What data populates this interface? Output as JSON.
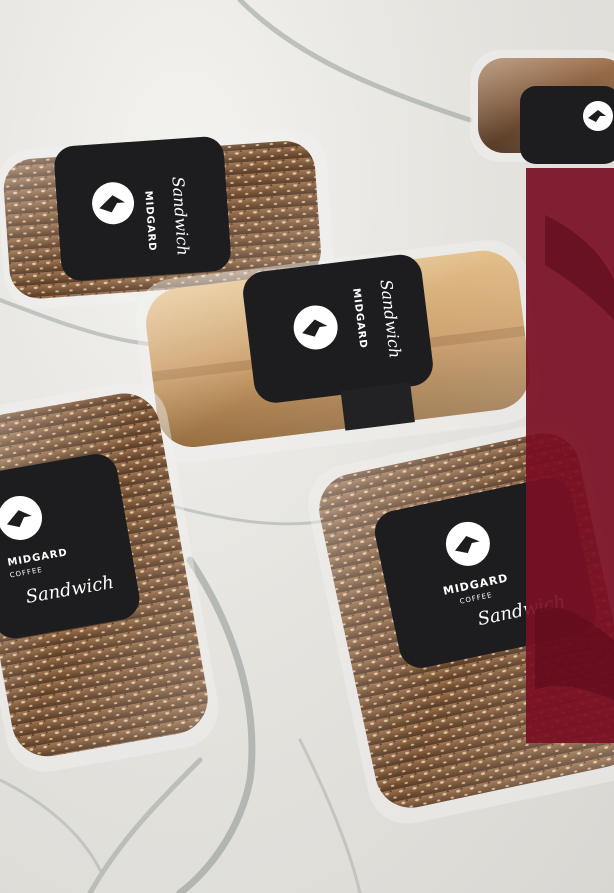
{
  "brand": {
    "name": "MIDGARD",
    "sub": "COFFEE",
    "script": "Sandwich"
  },
  "colors": {
    "marble": "#e6e4df",
    "vein": "#8d948f",
    "label": "#1d1d1f",
    "panel": "#7a0f24",
    "bread_light": "#c99a61",
    "bread_dark": "#6b4528"
  }
}
